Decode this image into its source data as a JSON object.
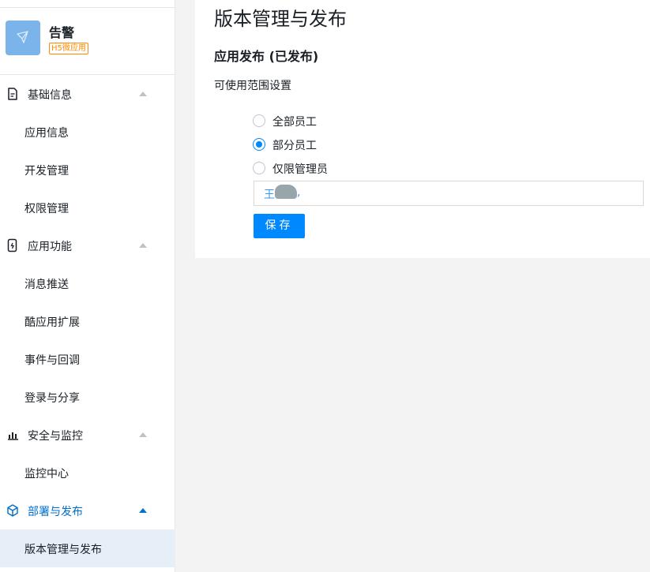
{
  "app": {
    "name": "告警",
    "badge": "H5微应用"
  },
  "sidebar": {
    "groups": [
      {
        "label": "基础信息",
        "icon": "document-icon",
        "items": [
          "应用信息",
          "开发管理",
          "权限管理"
        ]
      },
      {
        "label": "应用功能",
        "icon": "phone-icon",
        "items": [
          "消息推送",
          "酷应用扩展",
          "事件与回调",
          "登录与分享"
        ]
      },
      {
        "label": "安全与监控",
        "icon": "bar-chart-icon",
        "items": [
          "监控中心"
        ]
      },
      {
        "label": "部署与发布",
        "icon": "cube-icon",
        "items": [
          "版本管理与发布"
        ]
      }
    ],
    "active_group": "部署与发布",
    "selected_item": "版本管理与发布"
  },
  "main": {
    "page_title": "版本管理与发布",
    "section_title": "应用发布 (已发布)",
    "range_label": "可使用范围设置",
    "options": [
      {
        "label": "全部员工",
        "checked": false
      },
      {
        "label": "部分员工",
        "checked": true
      },
      {
        "label": "仅限管理员",
        "checked": false
      }
    ],
    "member_input": {
      "tag_prefix": "王",
      "separator": ","
    },
    "save_label": "保存"
  },
  "colors": {
    "primary": "#0089ff",
    "active_text": "#0070cc",
    "selected_bg": "#e6eef8",
    "badge": "#ff8a00",
    "logo_bg": "#7bb4ea"
  }
}
